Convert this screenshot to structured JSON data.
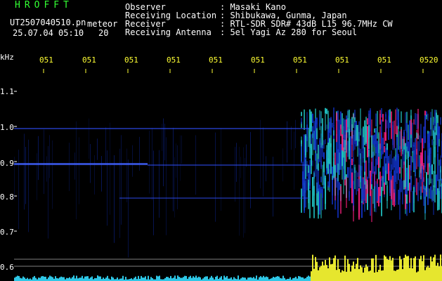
{
  "header": {
    "brand": "HROFFT",
    "filename": "UT2507040510.pn",
    "tag": "meteor",
    "datetime": "25.07.04 05:10",
    "count": "20"
  },
  "meta": {
    "observer_label": "Observer",
    "observer_value": ": Masaki Kano",
    "location_label": "Receiving Location",
    "location_value": ": Shibukawa, Gunma, Japan",
    "receiver_label": "Receiver",
    "receiver_value": ": RTL-SDR SDR# 43dB L15 96.7MHz CW",
    "antenna_label": "Receiving Antenna",
    "antenna_value": ": 5el Yagi Az 280 for Seoul"
  },
  "axis": {
    "unit": "kHz",
    "y_ticks": [
      "1.1",
      "1.0",
      "0.9",
      "0.8",
      "0.7",
      "0.6"
    ],
    "x_ticks": [
      "051",
      "051",
      "051",
      "051",
      "051",
      "051",
      "051",
      "051",
      "051",
      "0520"
    ]
  },
  "colors": {
    "background": "#000000",
    "header_green": "#33ff33",
    "text_white": "#ffffff",
    "ticks_yellow": "#ffff33",
    "signal_low": "#1030c0",
    "signal_mid": "#20c0c0",
    "signal_high": "#ff2080"
  }
}
